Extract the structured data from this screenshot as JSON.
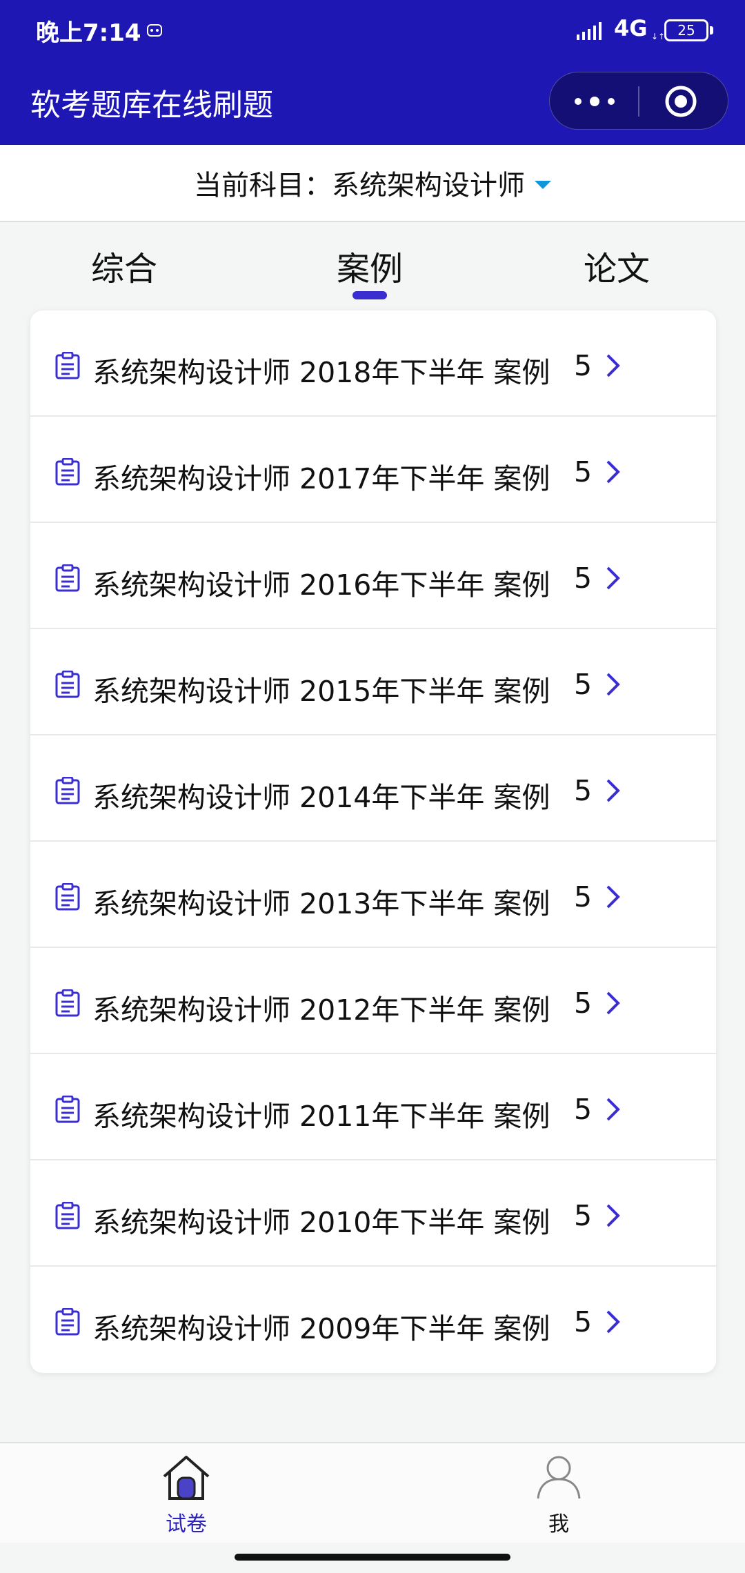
{
  "status_bar": {
    "time": "晚上7:14",
    "network": "4G",
    "battery": "25"
  },
  "nav": {
    "title": "软考题库在线刷题"
  },
  "subject": {
    "label": "当前科目：系统架构设计师"
  },
  "tabs": [
    {
      "label": "综合",
      "active": false
    },
    {
      "label": "案例",
      "active": true
    },
    {
      "label": "论文",
      "active": false
    }
  ],
  "exam_list": [
    {
      "title": "系统架构设计师 2018年下半年 案例",
      "count": "5"
    },
    {
      "title": "系统架构设计师 2017年下半年 案例",
      "count": "5"
    },
    {
      "title": "系统架构设计师 2016年下半年 案例",
      "count": "5"
    },
    {
      "title": "系统架构设计师 2015年下半年 案例",
      "count": "5"
    },
    {
      "title": "系统架构设计师 2014年下半年 案例",
      "count": "5"
    },
    {
      "title": "系统架构设计师 2013年下半年 案例",
      "count": "5"
    },
    {
      "title": "系统架构设计师 2012年下半年 案例",
      "count": "5"
    },
    {
      "title": "系统架构设计师 2011年下半年 案例",
      "count": "5"
    },
    {
      "title": "系统架构设计师 2010年下半年 案例",
      "count": "5"
    },
    {
      "title": "系统架构设计师 2009年下半年 案例",
      "count": "5"
    }
  ],
  "tabbar": {
    "items": [
      {
        "label": "试卷",
        "icon": "home-icon",
        "active": true
      },
      {
        "label": "我",
        "icon": "user-icon",
        "active": false
      }
    ]
  },
  "colors": {
    "primary": "#1f17b4",
    "accent": "#3a2ed0",
    "caret": "#1296db"
  }
}
